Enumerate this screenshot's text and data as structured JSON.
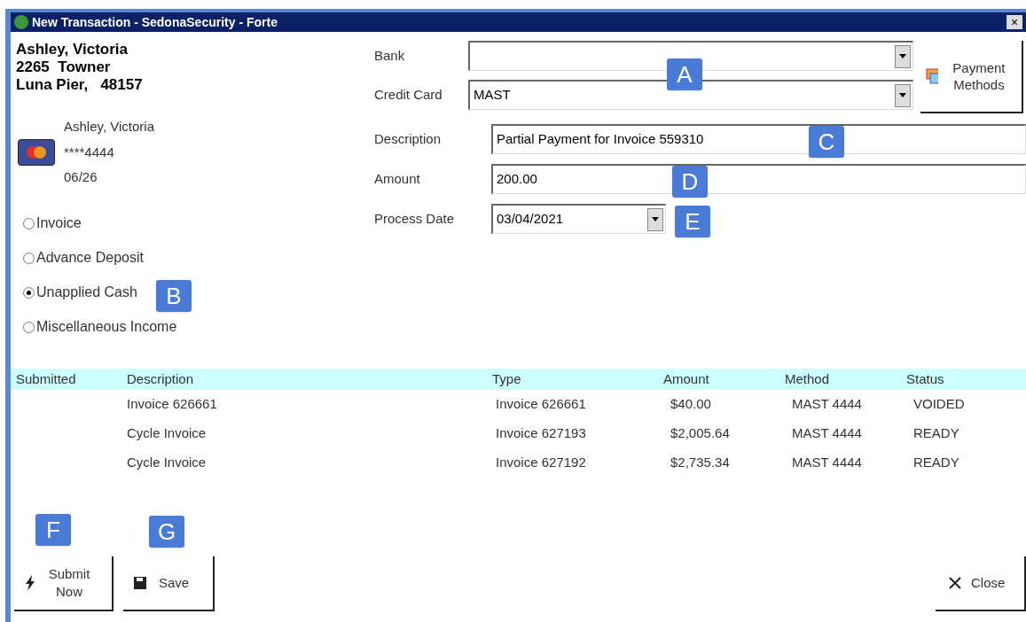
{
  "window": {
    "title": "New Transaction - SedonaSecurity - Forte",
    "close": "×"
  },
  "customer": {
    "name": "Ashley, Victoria",
    "street": "2265  Towner",
    "city": "Luna Pier,   48157"
  },
  "card": {
    "holder": "Ashley, Victoria",
    "number": "****4444",
    "expiry": "06/26"
  },
  "payment_types": [
    {
      "label": "Invoice",
      "selected": false
    },
    {
      "label": "Advance Deposit",
      "selected": false
    },
    {
      "label": "Unapplied Cash",
      "selected": true
    },
    {
      "label": "Miscellaneous Income",
      "selected": false
    }
  ],
  "form": {
    "bank": {
      "label": "Bank"
    },
    "credit_card": {
      "label": "Credit Card",
      "value": "MAST"
    },
    "description": {
      "label": "Description",
      "value": "Partial Payment for Invoice 559310"
    },
    "amount": {
      "label": "Amount",
      "value": "200.00"
    },
    "process_date": {
      "label": "Process Date",
      "value": "03/04/2021"
    },
    "payment_methods_button": "Payment Methods"
  },
  "table": {
    "columns": [
      "Submitted",
      "Description",
      "Type",
      "Amount",
      "Method",
      "Status"
    ],
    "rows": [
      [
        "",
        "Invoice 626661",
        "Invoice 626661",
        "$40.00",
        "MAST 4444",
        "VOIDED"
      ],
      [
        "",
        "Cycle Invoice",
        "Invoice 627193",
        "$2,005.64",
        "MAST 4444",
        "READY"
      ],
      [
        "",
        "Cycle Invoice",
        "Invoice 627192",
        "$2,735.34",
        "MAST 4444",
        "READY"
      ]
    ]
  },
  "buttons": {
    "submit": "Submit Now",
    "save": "Save",
    "close": "Close"
  },
  "callouts": [
    "A",
    "B",
    "C",
    "D",
    "E",
    "F",
    "G"
  ]
}
